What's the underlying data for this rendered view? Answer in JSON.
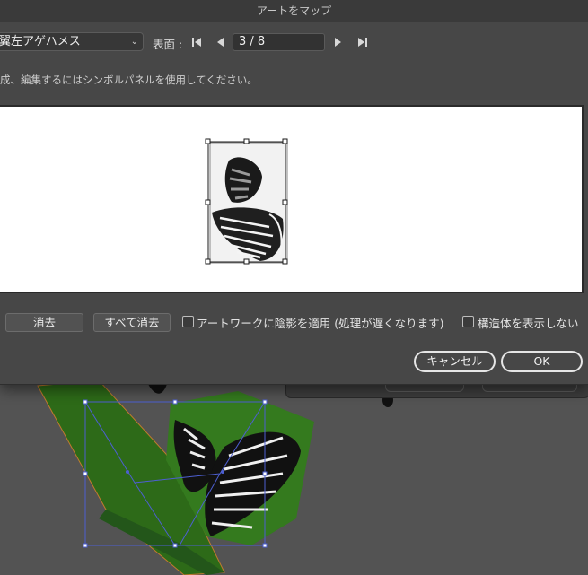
{
  "window": {
    "title": "アートをマップ"
  },
  "toolbar": {
    "symbol_value": "翼左アゲハメス",
    "surface_label": "表面 :",
    "page_value": "3 / 8"
  },
  "hint_text": "成、編集するにはシンボルパネルを使用してください。",
  "actions": {
    "clear_label": "消去",
    "clear_all_label": "すべて消去",
    "shade_label": "アートワークに陰影を適用 (処理が遅くなります)",
    "shade_checked": false,
    "invisible_geometry_label": "構造体を表示しない",
    "invisible_geometry_checked": false
  },
  "footer": {
    "cancel_label": "キャンセル",
    "ok_label": "OK"
  },
  "icons": {
    "first": "skip-first-icon",
    "prev": "triangle-left-icon",
    "next": "triangle-right-icon",
    "last": "skip-last-icon",
    "dropdown": "chevron-down-icon"
  },
  "colors": {
    "dialog_bg": "#474747",
    "canvas_bg": "#535353",
    "object_green": "#2f6e1a",
    "selection_blue": "#4d5fd1",
    "object_edge": "#c27a2e"
  }
}
